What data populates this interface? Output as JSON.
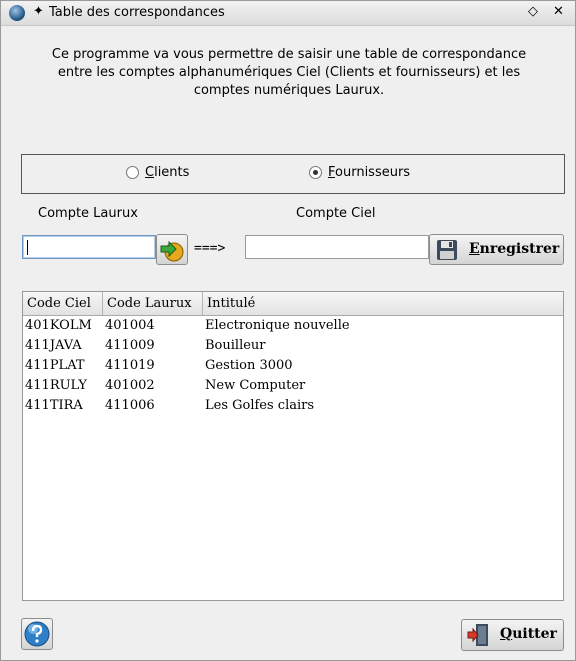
{
  "window": {
    "title": "Table des correspondances",
    "pin_symbol": "✦",
    "restore_symbol": "◇",
    "close_symbol": "✕"
  },
  "intro_text": "Ce programme va vous permettre de saisir une table de correspondance entre les comptes alphanumériques Ciel (Clients et fournisseurs) et les comptes numériques Laurux.",
  "intro_lines": [
    "Ce programme va vous permettre de saisir une table de correspondance",
    "entre les comptes alphanumériques Ciel (Clients et fournisseurs) et les",
    "comptes numériques Laurux."
  ],
  "radio": {
    "clients": {
      "label_first": "C",
      "label_rest": "lients",
      "selected": false
    },
    "fournisseurs": {
      "label_first": "F",
      "label_rest": "ournisseurs",
      "selected": true
    }
  },
  "form": {
    "compte_laurux_label": "Compte Laurux",
    "compte_ciel_label": "Compte Ciel",
    "compte_laurux_value": "",
    "compte_ciel_value": "",
    "arrow_text": "===>",
    "save_first": "E",
    "save_rest": "nregistrer"
  },
  "table": {
    "columns": [
      "Code Ciel",
      "Code Laurux",
      "Intitulé"
    ],
    "rows": [
      [
        "401KOLM",
        "401004",
        "Electronique nouvelle"
      ],
      [
        "411JAVA",
        "411009",
        "Bouilleur"
      ],
      [
        "411PLAT",
        "411019",
        "Gestion 3000"
      ],
      [
        "411RULY",
        "401002",
        "New Computer"
      ],
      [
        "411TIRA",
        "411006",
        "Les Golfes clairs"
      ]
    ]
  },
  "footer": {
    "quit_first": "Q",
    "quit_rest": "uitter"
  },
  "icons": {
    "app": "app-logo-icon",
    "validate": "arrow-right-icon",
    "save": "floppy-disk-icon",
    "help": "help-icon",
    "quit": "exit-door-icon"
  },
  "colors": {
    "accent": "#6a97c4",
    "border": "#9a9a9a"
  }
}
